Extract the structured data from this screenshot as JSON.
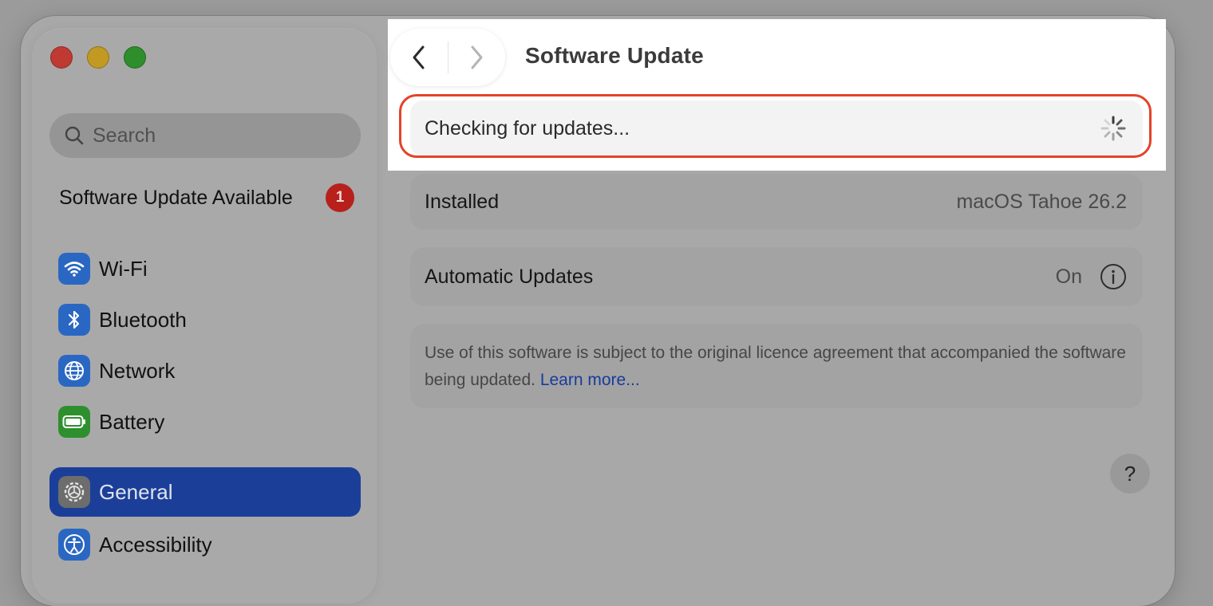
{
  "sidebar": {
    "search_placeholder": "Search",
    "update_available_label": "Software Update Available",
    "update_badge_count": "1",
    "items": [
      {
        "label": "Wi-Fi",
        "icon": "wifi-icon"
      },
      {
        "label": "Bluetooth",
        "icon": "bluetooth-icon"
      },
      {
        "label": "Network",
        "icon": "globe-icon"
      },
      {
        "label": "Battery",
        "icon": "battery-icon"
      },
      {
        "label": "General",
        "icon": "gear-icon",
        "selected": true
      },
      {
        "label": "Accessibility",
        "icon": "accessibility-icon"
      }
    ]
  },
  "header": {
    "title": "Software Update"
  },
  "main": {
    "checking_text": "Checking for updates...",
    "installed": {
      "label": "Installed",
      "value": "macOS Tahoe 26.2"
    },
    "automatic_updates": {
      "label": "Automatic Updates",
      "value": "On"
    },
    "notice_text": "Use of this software is subject to the original licence agreement that accompanied the software being updated.",
    "notice_link": "Learn more...",
    "help_label": "?"
  },
  "colors": {
    "highlight": "#e4432b",
    "selected": "#1b3f99",
    "badge": "#b8201c",
    "link": "#163c9d"
  }
}
